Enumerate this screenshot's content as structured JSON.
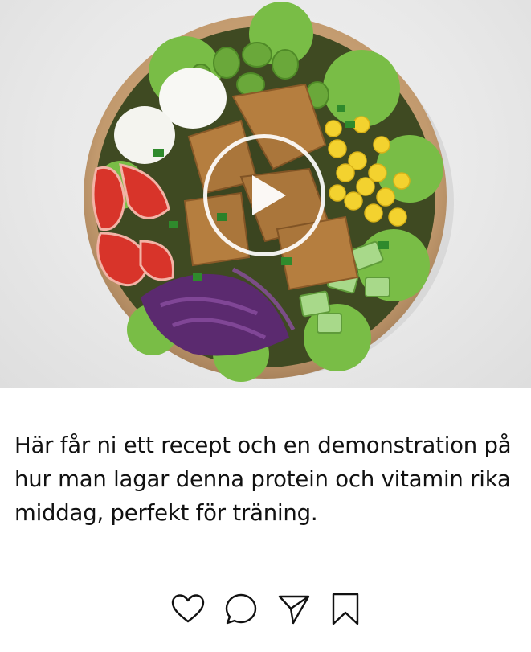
{
  "post": {
    "media": {
      "type": "video",
      "description_icon": "play-icon"
    },
    "caption": "Här får ni ett recept och en demonstration på hur man lagar denna protein och vitamin rika middag, perfekt för träning.",
    "actions": [
      {
        "name": "like",
        "icon": "heart-icon"
      },
      {
        "name": "comment",
        "icon": "comment-icon"
      },
      {
        "name": "share",
        "icon": "send-icon"
      },
      {
        "name": "save",
        "icon": "bookmark-icon"
      }
    ]
  },
  "colors": {
    "background": "#ffffff",
    "text": "#111111",
    "media_background": "#e6e6e6",
    "bowl": "#c8a27a",
    "lettuce": "#7cc04a",
    "edamame": "#6aa83a",
    "corn": "#f2d12e",
    "tomato": "#d8342a",
    "cabbage": "#5a2a6e",
    "chicken": "#b07a3c",
    "egg": "#f8f8f4"
  }
}
